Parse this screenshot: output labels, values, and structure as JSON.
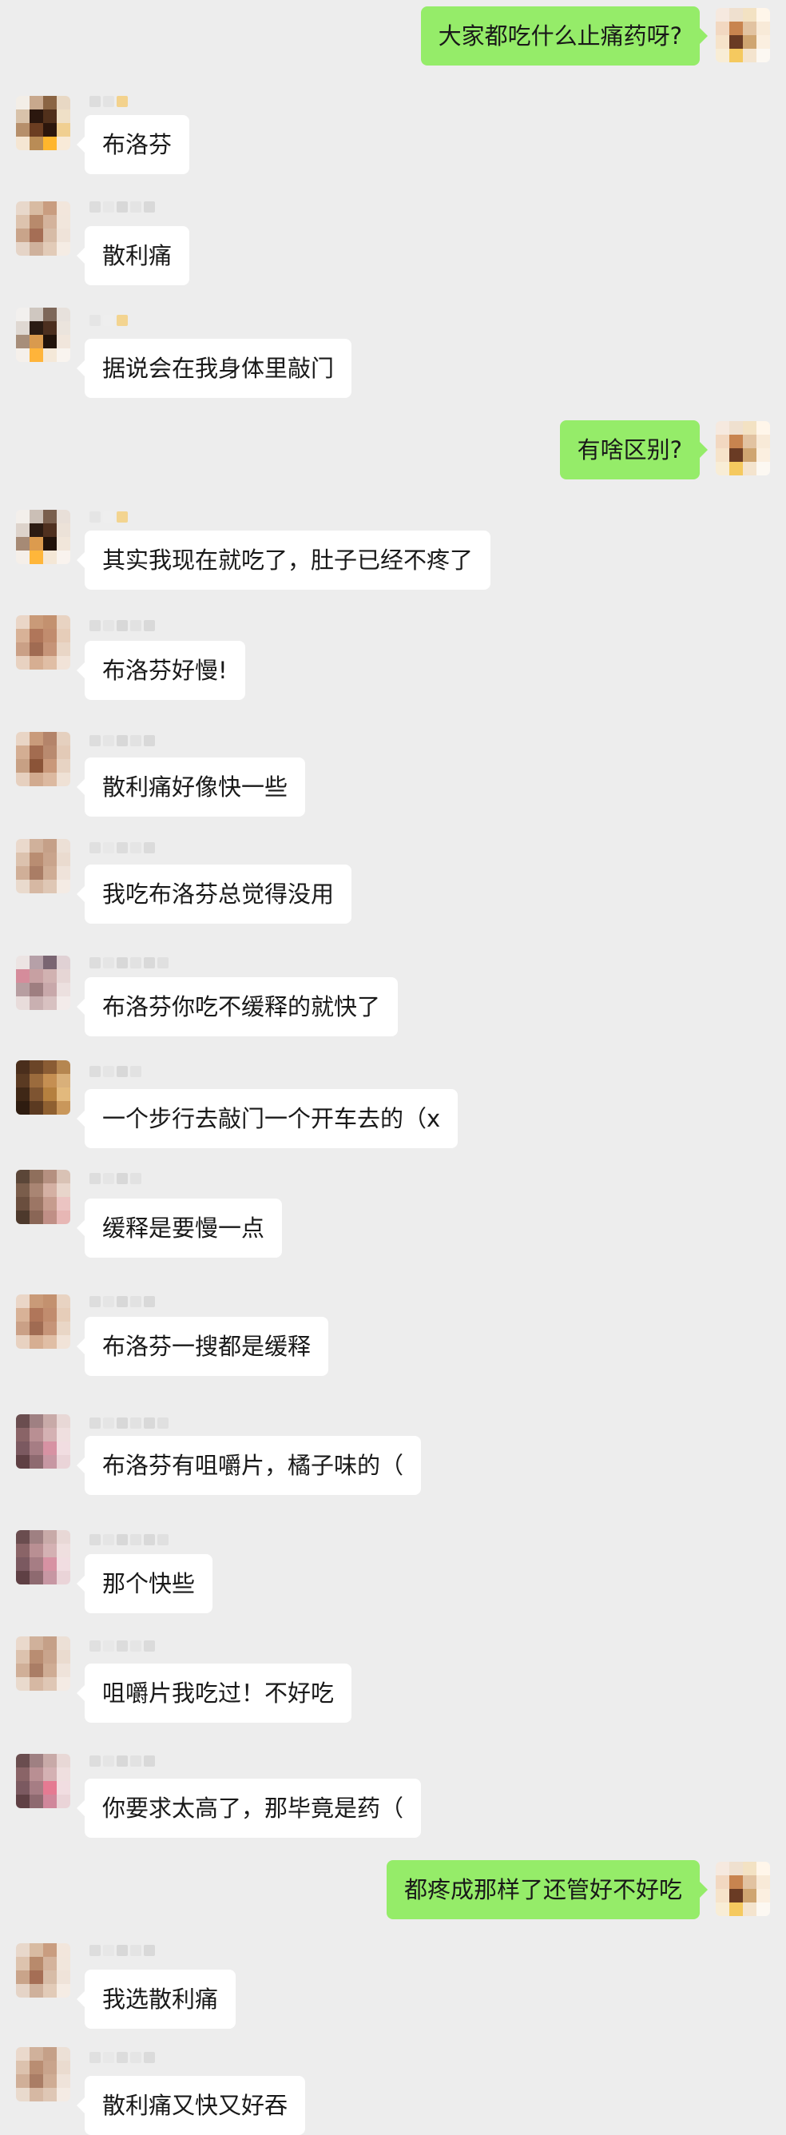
{
  "messages": [
    {
      "side": "right",
      "text": "大家都吃什么止痛药呀?",
      "avatar": [
        "#f6e9df",
        "#efe0cf",
        "#f3e2c3",
        "#fff6ea",
        "#f2d8c1",
        "#c8844f",
        "#e2c3a1",
        "#f8ead8",
        "#f6e3ca",
        "#6a3b24",
        "#cfa571",
        "#fbefe0",
        "#f8edd6",
        "#f5c95f",
        "#f4e4ce",
        "#fcf8f2"
      ],
      "name_pixels": []
    },
    {
      "side": "left",
      "text": "布洛芬",
      "avatar": [
        "#f3eee7",
        "#c8a88d",
        "#8a6443",
        "#e8d8c4",
        "#d8c2aa",
        "#2b170e",
        "#51301b",
        "#efe0c7",
        "#b68f6b",
        "#6b3d21",
        "#2c160c",
        "#f0cf91",
        "#f5e6d3",
        "#b98c56",
        "#ffb62d",
        "#f8ead8"
      ],
      "name_pixels": [
        "#dddddd",
        "#e3e3e3",
        "#f3d28d"
      ]
    },
    {
      "side": "left",
      "text": "散利痛",
      "avatar": [
        "#e8d8cb",
        "#d8bba2",
        "#c99d80",
        "#f2e6dc",
        "#ddc3ae",
        "#b88a6c",
        "#d4b39c",
        "#f1e6dc",
        "#c9a48a",
        "#a56e55",
        "#d7bca7",
        "#efe3d9",
        "#e5d4c7",
        "#cfb19c",
        "#e2cbb8",
        "#f5ece4"
      ],
      "name_pixels": [
        "#dddddd",
        "#e7e7e7",
        "#d8d8d8",
        "#e4e4e4",
        "#d9d9d9"
      ]
    },
    {
      "side": "left",
      "text": "据说会在我身体里敲门",
      "avatar": [
        "#f2f0ee",
        "#cfc7c0",
        "#7d6759",
        "#e7e1dc",
        "#dfd8d2",
        "#2a1b13",
        "#4c2f1f",
        "#ebe4dd",
        "#a78e7a",
        "#d99a4e",
        "#22130b",
        "#f1e6dc",
        "#f5f0eb",
        "#ffb43a",
        "#f4e8d8",
        "#f9f4ef"
      ],
      "name_pixels": [
        "#e5e5e5",
        "#eeeeee",
        "#f3d490"
      ]
    },
    {
      "side": "right",
      "text": "有啥区别?",
      "avatar": [
        "#f6e9df",
        "#efe0cf",
        "#f3e2c3",
        "#fff6ea",
        "#f2d8c1",
        "#c8844f",
        "#e2c3a1",
        "#f8ead8",
        "#f6e3ca",
        "#6a3b24",
        "#cfa571",
        "#fbefe0",
        "#f8edd6",
        "#f5c95f",
        "#f4e4ce",
        "#fcf8f2"
      ],
      "name_pixels": []
    },
    {
      "side": "left",
      "text": "其实我现在就吃了，肚子已经不疼了",
      "avatar": [
        "#f3efeb",
        "#cbbfb6",
        "#7a5f4d",
        "#e8dfd8",
        "#ddd3cb",
        "#2c1b12",
        "#4f301f",
        "#ece2d8",
        "#a68a75",
        "#dc9b4e",
        "#21120a",
        "#f1e6da",
        "#f5efe9",
        "#ffb63a",
        "#f4e7d6",
        "#f9f3ee"
      ],
      "name_pixels": [
        "#e5e5e5",
        "#eeeeee",
        "#f3d490"
      ]
    },
    {
      "side": "left",
      "text": "布洛芬好慢!",
      "avatar": [
        "#ead6c7",
        "#c99a78",
        "#c3916f",
        "#e8d3c2",
        "#d8b297",
        "#b0765a",
        "#c18c6e",
        "#e6cdb9",
        "#caa086",
        "#a06b52",
        "#c69478",
        "#e9d6c6",
        "#e8d2c1",
        "#d6ae92",
        "#e0bea5",
        "#f1e3d8"
      ],
      "name_pixels": [
        "#dddddd",
        "#e5e5e5",
        "#d8d8d8",
        "#e2e2e2",
        "#d9d9d9"
      ]
    },
    {
      "side": "left",
      "text": "散利痛好像快一些",
      "avatar": [
        "#e9d5c5",
        "#c99b7b",
        "#b4846a",
        "#e5d0bf",
        "#d4ae93",
        "#a36c50",
        "#b98a6f",
        "#e3cab7",
        "#c7a084",
        "#8b5438",
        "#c9987a",
        "#e7d3c3",
        "#e6d0bf",
        "#d1aa8f",
        "#dcb9a0",
        "#efe1d5"
      ],
      "name_pixels": [
        "#dddddd",
        "#e5e5e5",
        "#d8d8d8",
        "#e2e2e2",
        "#d9d9d9"
      ]
    },
    {
      "side": "left",
      "text": "我吃布洛芬总觉得没用",
      "avatar": [
        "#ead9cc",
        "#d0b19b",
        "#c5a088",
        "#ece0d6",
        "#dcc2ae",
        "#b98d72",
        "#c9a48c",
        "#eadbcf",
        "#d0af98",
        "#aa7d65",
        "#cfac94",
        "#efe3da",
        "#e9dacd",
        "#d6b8a3",
        "#dfc7b5",
        "#f4ebe4"
      ],
      "name_pixels": [
        "#e0e0e0",
        "#e8e8e8",
        "#dcdcdc",
        "#e5e5e5",
        "#dbdbdb"
      ]
    },
    {
      "side": "left",
      "text": "布洛芬你吃不缓释的就快了",
      "avatar": [
        "#ece4e3",
        "#b6a0a8",
        "#7a6572",
        "#e0d1d4",
        "#d58c9b",
        "#c7a0a2",
        "#d1b2b1",
        "#e6d6d5",
        "#b79ea1",
        "#9e7e80",
        "#c8a8aa",
        "#ece0df",
        "#e8dcdb",
        "#c9b0b1",
        "#d8c1c1",
        "#f3ebea"
      ],
      "name_pixels": [
        "#dddddd",
        "#e5e5e5",
        "#d8d8d8",
        "#e2e2e2",
        "#d9d9d9",
        "#e0e0e0"
      ]
    },
    {
      "side": "left",
      "text": "一个步行去敲门一个开车去的（x",
      "avatar": [
        "#4a2e1c",
        "#6b4528",
        "#8a5c34",
        "#b58650",
        "#5a3a22",
        "#9b6b3d",
        "#c58f52",
        "#d9b07a",
        "#3f2716",
        "#7e5431",
        "#b5803f",
        "#e2b97d",
        "#2e1c10",
        "#5b3a21",
        "#8f6031",
        "#c9975b"
      ],
      "name_pixels": [
        "#dddddd",
        "#e5e5e5",
        "#d8d8d8",
        "#e2e2e2"
      ]
    },
    {
      "side": "left",
      "text": "缓释是要慢一点",
      "avatar": [
        "#5b4638",
        "#8f6f5c",
        "#b59080",
        "#d9c2b5",
        "#7a5d4b",
        "#a98573",
        "#d4b0a3",
        "#e8d5cb",
        "#6a4e3e",
        "#9c7665",
        "#c69c8e",
        "#ebc4c2",
        "#4d392c",
        "#8a6656",
        "#c08f86",
        "#e7b7b5"
      ],
      "name_pixels": [
        "#dddddd",
        "#e5e5e5",
        "#d8d8d8",
        "#e2e2e2"
      ]
    },
    {
      "side": "left",
      "text": "布洛芬一搜都是缓释",
      "avatar": [
        "#ead6c7",
        "#c99a78",
        "#c3916f",
        "#e8d3c2",
        "#d8b297",
        "#b0765a",
        "#c18c6e",
        "#e6cdb9",
        "#caa086",
        "#a06b52",
        "#c69478",
        "#e9d6c6",
        "#e8d2c1",
        "#d6ae92",
        "#e0bea5",
        "#f1e3d8"
      ],
      "name_pixels": [
        "#dddddd",
        "#e5e5e5",
        "#d8d8d8",
        "#e2e2e2",
        "#d9d9d9"
      ]
    },
    {
      "side": "left",
      "text": "布洛芬有咀嚼片，橘子味的（",
      "avatar": [
        "#6a4d4f",
        "#9f8082",
        "#c8aaa8",
        "#e8d8d6",
        "#8a6467",
        "#b98f93",
        "#d4b1b3",
        "#efdfdf",
        "#7b5960",
        "#a67d84",
        "#d792a3",
        "#f1dde1",
        "#5f4044",
        "#8e6a70",
        "#c797a3",
        "#ead4d8"
      ],
      "name_pixels": [
        "#dddddd",
        "#e5e5e5",
        "#d8d8d8",
        "#e2e2e2",
        "#d9d9d9",
        "#e0e0e0"
      ]
    },
    {
      "side": "left",
      "text": "那个快些",
      "avatar": [
        "#6a4d4f",
        "#9f8082",
        "#c8aaa8",
        "#e8d8d6",
        "#8a6467",
        "#b98f93",
        "#d4b1b3",
        "#efdfdf",
        "#7b5960",
        "#a67d84",
        "#d792a3",
        "#f1dde1",
        "#5f4044",
        "#8e6a70",
        "#c797a3",
        "#ead4d8"
      ],
      "name_pixels": [
        "#dddddd",
        "#e5e5e5",
        "#d8d8d8",
        "#e2e2e2",
        "#d9d9d9",
        "#e0e0e0"
      ]
    },
    {
      "side": "left",
      "text": "咀嚼片我吃过！不好吃",
      "avatar": [
        "#ead9cc",
        "#d0b19b",
        "#c5a088",
        "#ece0d6",
        "#dcc2ae",
        "#b98d72",
        "#c9a48c",
        "#eadbcf",
        "#d0af98",
        "#aa7d65",
        "#cfac94",
        "#efe3da",
        "#e9dacd",
        "#d6b8a3",
        "#dfc7b5",
        "#f4ebe4"
      ],
      "name_pixels": [
        "#e0e0e0",
        "#e8e8e8",
        "#dcdcdc",
        "#e5e5e5",
        "#dbdbdb"
      ]
    },
    {
      "side": "left",
      "text": "你要求太高了，那毕竟是药（",
      "avatar": [
        "#6a4d4f",
        "#9f8082",
        "#c8aaa8",
        "#e8d8d6",
        "#8a6467",
        "#b98f93",
        "#d4b1b3",
        "#efdfdf",
        "#7b5960",
        "#a67d84",
        "#e57a92",
        "#f1dde1",
        "#5f4044",
        "#8e6a70",
        "#d0879b",
        "#ead4d8"
      ],
      "name_pixels": [
        "#dddddd",
        "#e5e5e5",
        "#d8d8d8",
        "#e2e2e2",
        "#d9d9d9"
      ]
    },
    {
      "side": "right",
      "text": "都疼成那样了还管好不好吃",
      "avatar": [
        "#f6e9df",
        "#efe0cf",
        "#f3e2c3",
        "#fff6ea",
        "#f2d8c1",
        "#c8844f",
        "#e2c3a1",
        "#f8ead8",
        "#f6e3ca",
        "#6a3b24",
        "#cfa571",
        "#fbefe0",
        "#f8edd6",
        "#f5c95f",
        "#f4e4ce",
        "#fcf8f2"
      ],
      "name_pixels": []
    },
    {
      "side": "left",
      "text": "我选散利痛",
      "avatar": [
        "#e8d8cb",
        "#d8bba2",
        "#c99d80",
        "#f2e6dc",
        "#ddc3ae",
        "#b88a6c",
        "#d4b39c",
        "#f1e6dc",
        "#c9a48a",
        "#a56e55",
        "#d7bca7",
        "#efe3d9",
        "#e5d4c7",
        "#cfb19c",
        "#e2cbb8",
        "#f5ece4"
      ],
      "name_pixels": [
        "#dddddd",
        "#e7e7e7",
        "#d8d8d8",
        "#e4e4e4",
        "#d9d9d9"
      ]
    },
    {
      "side": "left",
      "text": "散利痛又快又好吞",
      "avatar": [
        "#ead9cc",
        "#d0b19b",
        "#c5a088",
        "#ece0d6",
        "#dcc2ae",
        "#b98d72",
        "#c9a48c",
        "#eadbcf",
        "#d0af98",
        "#aa7d65",
        "#cfac94",
        "#efe3da",
        "#e9dacd",
        "#d6b8a3",
        "#dfc7b5",
        "#f4ebe4"
      ],
      "name_pixels": [
        "#e0e0e0",
        "#e8e8e8",
        "#dcdcdc",
        "#e5e5e5",
        "#dbdbdb"
      ]
    }
  ]
}
